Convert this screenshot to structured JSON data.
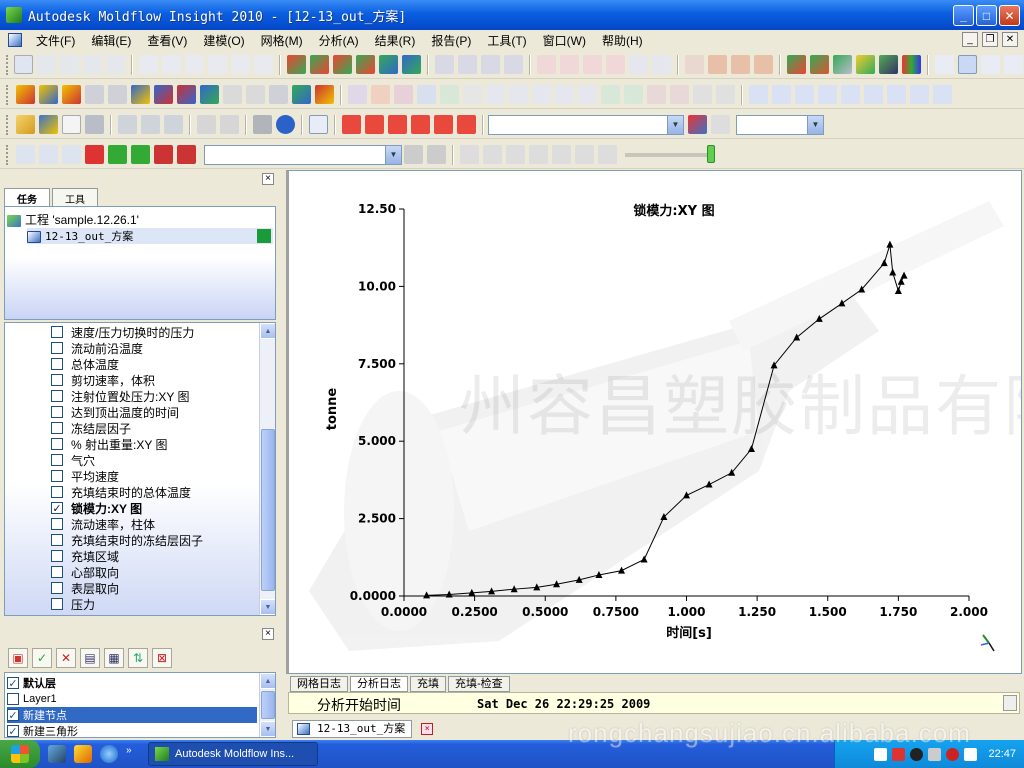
{
  "window": {
    "title": "Autodesk Moldflow Insight 2010 - [12-13_out_方案]"
  },
  "menu": [
    "文件(F)",
    "编辑(E)",
    "查看(V)",
    "建模(O)",
    "网格(M)",
    "分析(A)",
    "结果(R)",
    "报告(P)",
    "工具(T)",
    "窗口(W)",
    "帮助(H)"
  ],
  "task_panel": {
    "tabs": [
      "任务",
      "工具"
    ],
    "project": "工程 'sample.12.26.1'",
    "study": "12-13_out_方案"
  },
  "results": [
    {
      "label": "速度/压力切换时的压力",
      "checked": false
    },
    {
      "label": "流动前沿温度",
      "checked": false
    },
    {
      "label": "总体温度",
      "checked": false
    },
    {
      "label": "剪切速率，体积",
      "checked": false
    },
    {
      "label": "注射位置处压力:XY 图",
      "checked": false
    },
    {
      "label": "达到顶出温度的时间",
      "checked": false
    },
    {
      "label": "冻结层因子",
      "checked": false
    },
    {
      "label": "% 射出重量:XY 图",
      "checked": false
    },
    {
      "label": "气穴",
      "checked": false
    },
    {
      "label": "平均速度",
      "checked": false
    },
    {
      "label": "充填结束时的总体温度",
      "checked": false
    },
    {
      "label": "锁模力:XY 图",
      "checked": true
    },
    {
      "label": "流动速率，柱体",
      "checked": false
    },
    {
      "label": "充填结束时的冻结层因子",
      "checked": false
    },
    {
      "label": "充填区域",
      "checked": false
    },
    {
      "label": "心部取向",
      "checked": false
    },
    {
      "label": "表层取向",
      "checked": false
    },
    {
      "label": "压力",
      "checked": false
    }
  ],
  "layers": [
    {
      "label": "默认层",
      "checked": true,
      "bold": true,
      "selected": false
    },
    {
      "label": "Layer1",
      "checked": false,
      "bold": false,
      "selected": false
    },
    {
      "label": "新建节点",
      "checked": true,
      "bold": false,
      "selected": true
    },
    {
      "label": "新建三角形",
      "checked": true,
      "bold": false,
      "selected": false
    }
  ],
  "watermark": "州容昌塑胶制品有限公司",
  "chart_data": {
    "type": "line",
    "title": "锁模力:XY 图",
    "xlabel": "时间[s]",
    "ylabel": "tonne",
    "xlim": [
      0,
      2.0
    ],
    "ylim": [
      0,
      12.5
    ],
    "xticks": [
      "0.0000",
      "0.2500",
      "0.5000",
      "0.7500",
      "1.000",
      "1.250",
      "1.500",
      "1.750",
      "2.000"
    ],
    "yticks": [
      "0.0000",
      "2.500",
      "5.000",
      "7.500",
      "10.00",
      "12.50"
    ],
    "series": [
      {
        "x": [
          0.08,
          0.16,
          0.24,
          0.31,
          0.39,
          0.47,
          0.54,
          0.62,
          0.69,
          0.77,
          0.85,
          0.92,
          1.0,
          1.08,
          1.16,
          1.23,
          1.31,
          1.39,
          1.47,
          1.55,
          1.62,
          1.7,
          1.72,
          1.73,
          1.75,
          1.76,
          1.77
        ],
        "y": [
          0.02,
          0.05,
          0.1,
          0.15,
          0.22,
          0.28,
          0.38,
          0.52,
          0.68,
          0.82,
          1.18,
          2.55,
          3.25,
          3.6,
          3.98,
          4.75,
          7.45,
          8.35,
          8.95,
          9.45,
          9.9,
          10.75,
          11.35,
          10.45,
          9.85,
          10.15,
          10.35
        ]
      }
    ]
  },
  "log": {
    "tabs": [
      "网格日志",
      "分析日志",
      "充填",
      "充填-检查"
    ],
    "active": "分析日志",
    "key": "分析开始时间",
    "value": "Sat Dec 26 22:29:25 2009"
  },
  "doc_tab": "12-13_out_方案",
  "taskbar": {
    "task": "Autodesk Moldflow Ins...",
    "clock": "22:47"
  },
  "site_watermark": "rongchangsujiao.cn.alibaba.com"
}
